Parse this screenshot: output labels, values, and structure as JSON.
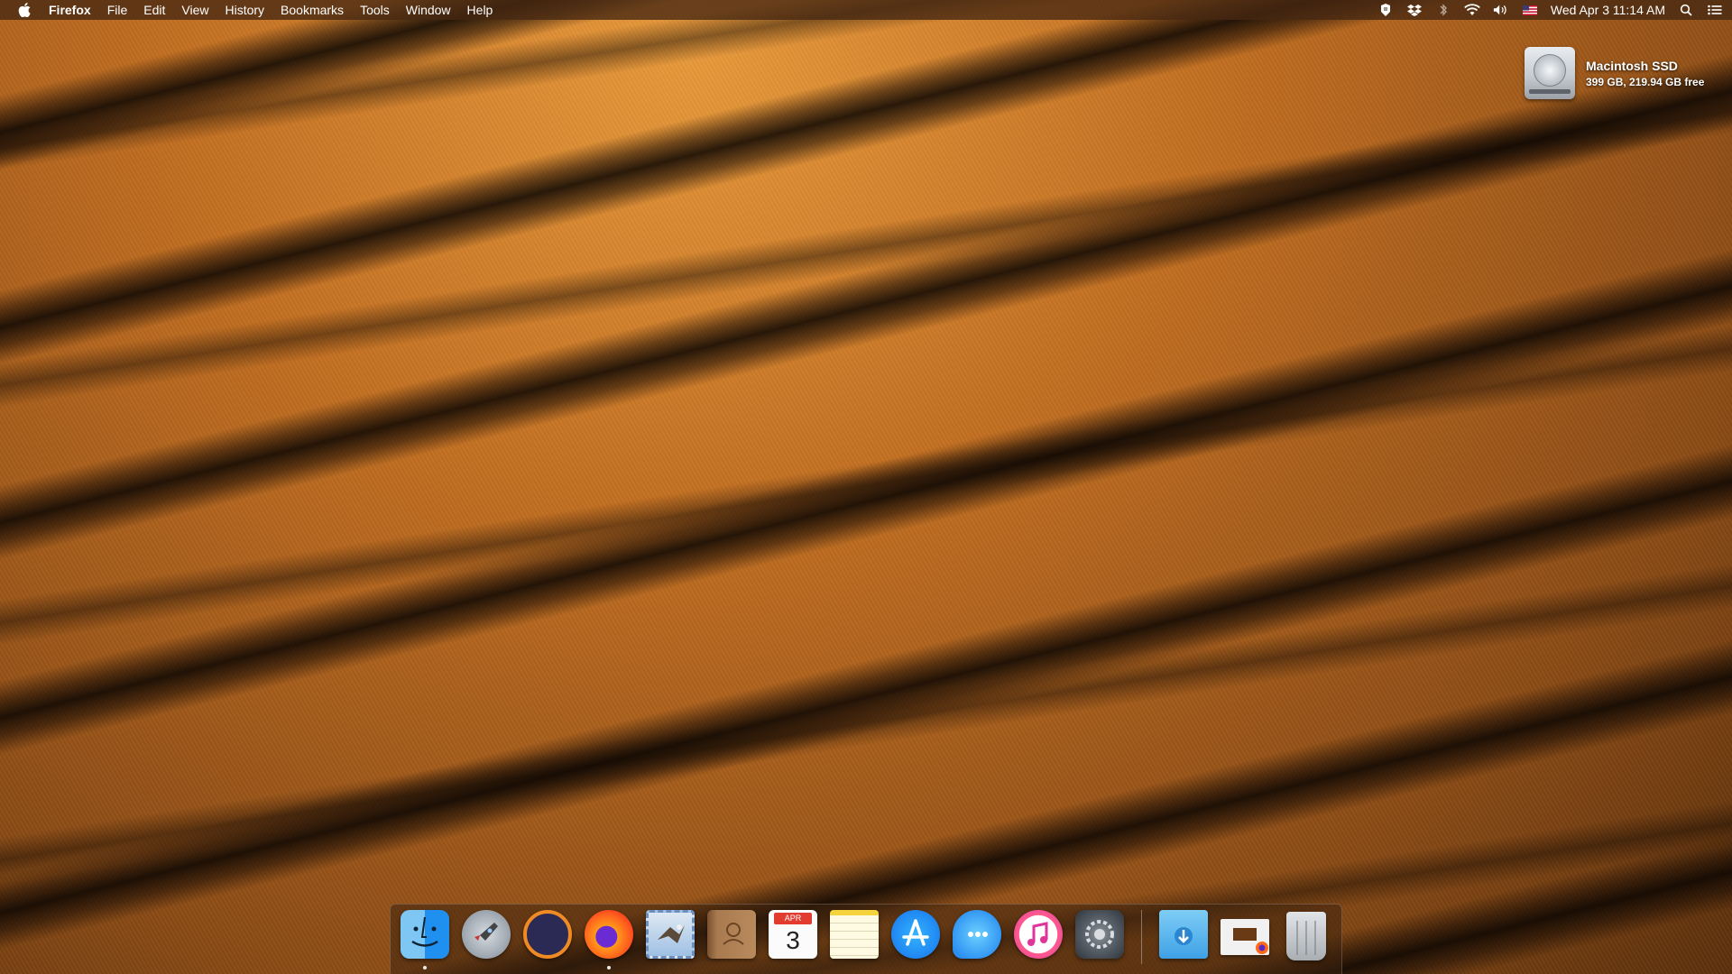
{
  "menubar": {
    "app_name": "Firefox",
    "menus": [
      "File",
      "Edit",
      "View",
      "History",
      "Bookmarks",
      "Tools",
      "Window",
      "Help"
    ],
    "status_icons": [
      "bear-app-icon",
      "dropbox-icon",
      "bluetooth-icon",
      "wifi-icon",
      "volume-icon",
      "us-flag-input-icon"
    ],
    "clock": "Wed Apr 3  11:14 AM"
  },
  "desktop": {
    "drive_name": "Macintosh SSD",
    "drive_info": "399 GB, 219.94 GB free"
  },
  "dock": {
    "apps": [
      {
        "name": "Finder",
        "icon": "finder-icon",
        "running": true
      },
      {
        "name": "Launchpad",
        "icon": "launchpad-icon",
        "running": false
      },
      {
        "name": "Eclipse",
        "icon": "eclipse-icon",
        "running": false
      },
      {
        "name": "Firefox",
        "icon": "firefox-icon",
        "running": true
      },
      {
        "name": "Mail",
        "icon": "mail-icon",
        "running": false
      },
      {
        "name": "Contacts",
        "icon": "contacts-icon",
        "running": false
      },
      {
        "name": "Calendar",
        "icon": "calendar-icon",
        "running": false
      },
      {
        "name": "Notes",
        "icon": "notes-icon",
        "running": false
      },
      {
        "name": "App Store",
        "icon": "app-store-icon",
        "running": false
      },
      {
        "name": "Messages",
        "icon": "messages-icon",
        "running": false
      },
      {
        "name": "iTunes",
        "icon": "itunes-icon",
        "running": false
      },
      {
        "name": "System Preferences",
        "icon": "system-preferences-icon",
        "running": false
      }
    ],
    "calendar_month": "APR",
    "calendar_day": "3",
    "stacks": [
      {
        "name": "Downloads",
        "icon": "downloads-folder-icon"
      },
      {
        "name": "Screenshot",
        "icon": "screenshot-file-icon"
      },
      {
        "name": "Trash",
        "icon": "trash-icon"
      }
    ]
  },
  "colors": {
    "menubar_bg": "#46281240",
    "dock_bg": "#3c220e"
  }
}
